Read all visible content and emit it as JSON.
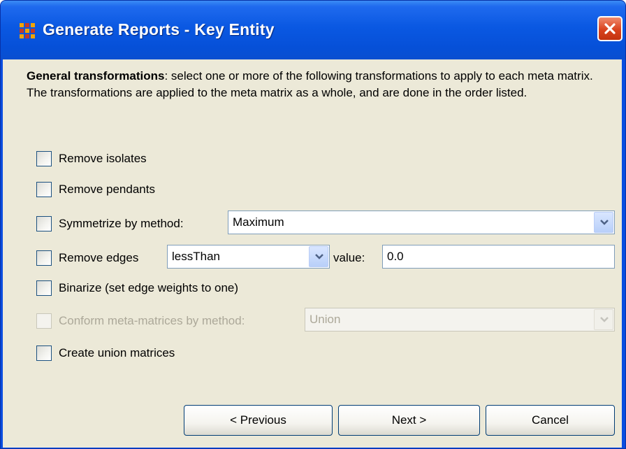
{
  "window": {
    "title": "Generate Reports - Key Entity"
  },
  "description": {
    "bold": "General transformations",
    "text": ": select one or more of the following transformations to apply to each meta matrix. The transformations are applied to the meta matrix as a whole, and are done in the order listed."
  },
  "options": {
    "remove_isolates": {
      "label": "Remove isolates",
      "checked": false
    },
    "remove_pendants": {
      "label": "Remove pendants",
      "checked": false
    },
    "symmetrize": {
      "label": "Symmetrize by method:",
      "checked": false,
      "method": "Maximum"
    },
    "remove_edges": {
      "label": "Remove edges",
      "checked": false,
      "comparator": "lessThan",
      "value_label": "value:",
      "value": "0.0"
    },
    "binarize": {
      "label": "Binarize (set edge weights to one)",
      "checked": false
    },
    "conform": {
      "label": "Conform meta-matrices by method:",
      "checked": false,
      "enabled": false,
      "method": "Union"
    },
    "create_union": {
      "label": "Create union matrices",
      "checked": false
    }
  },
  "buttons": {
    "previous": "< Previous",
    "next": "Next >",
    "cancel": "Cancel"
  },
  "icons": {
    "app": "meta-matrix-grid-icon",
    "close": "close-icon",
    "dropdown": "chevron-down-icon"
  },
  "colors": {
    "titlebar": "#0a58e2",
    "client": "#ece9d8",
    "close": "#d9421e",
    "icon": "#f2a300"
  }
}
